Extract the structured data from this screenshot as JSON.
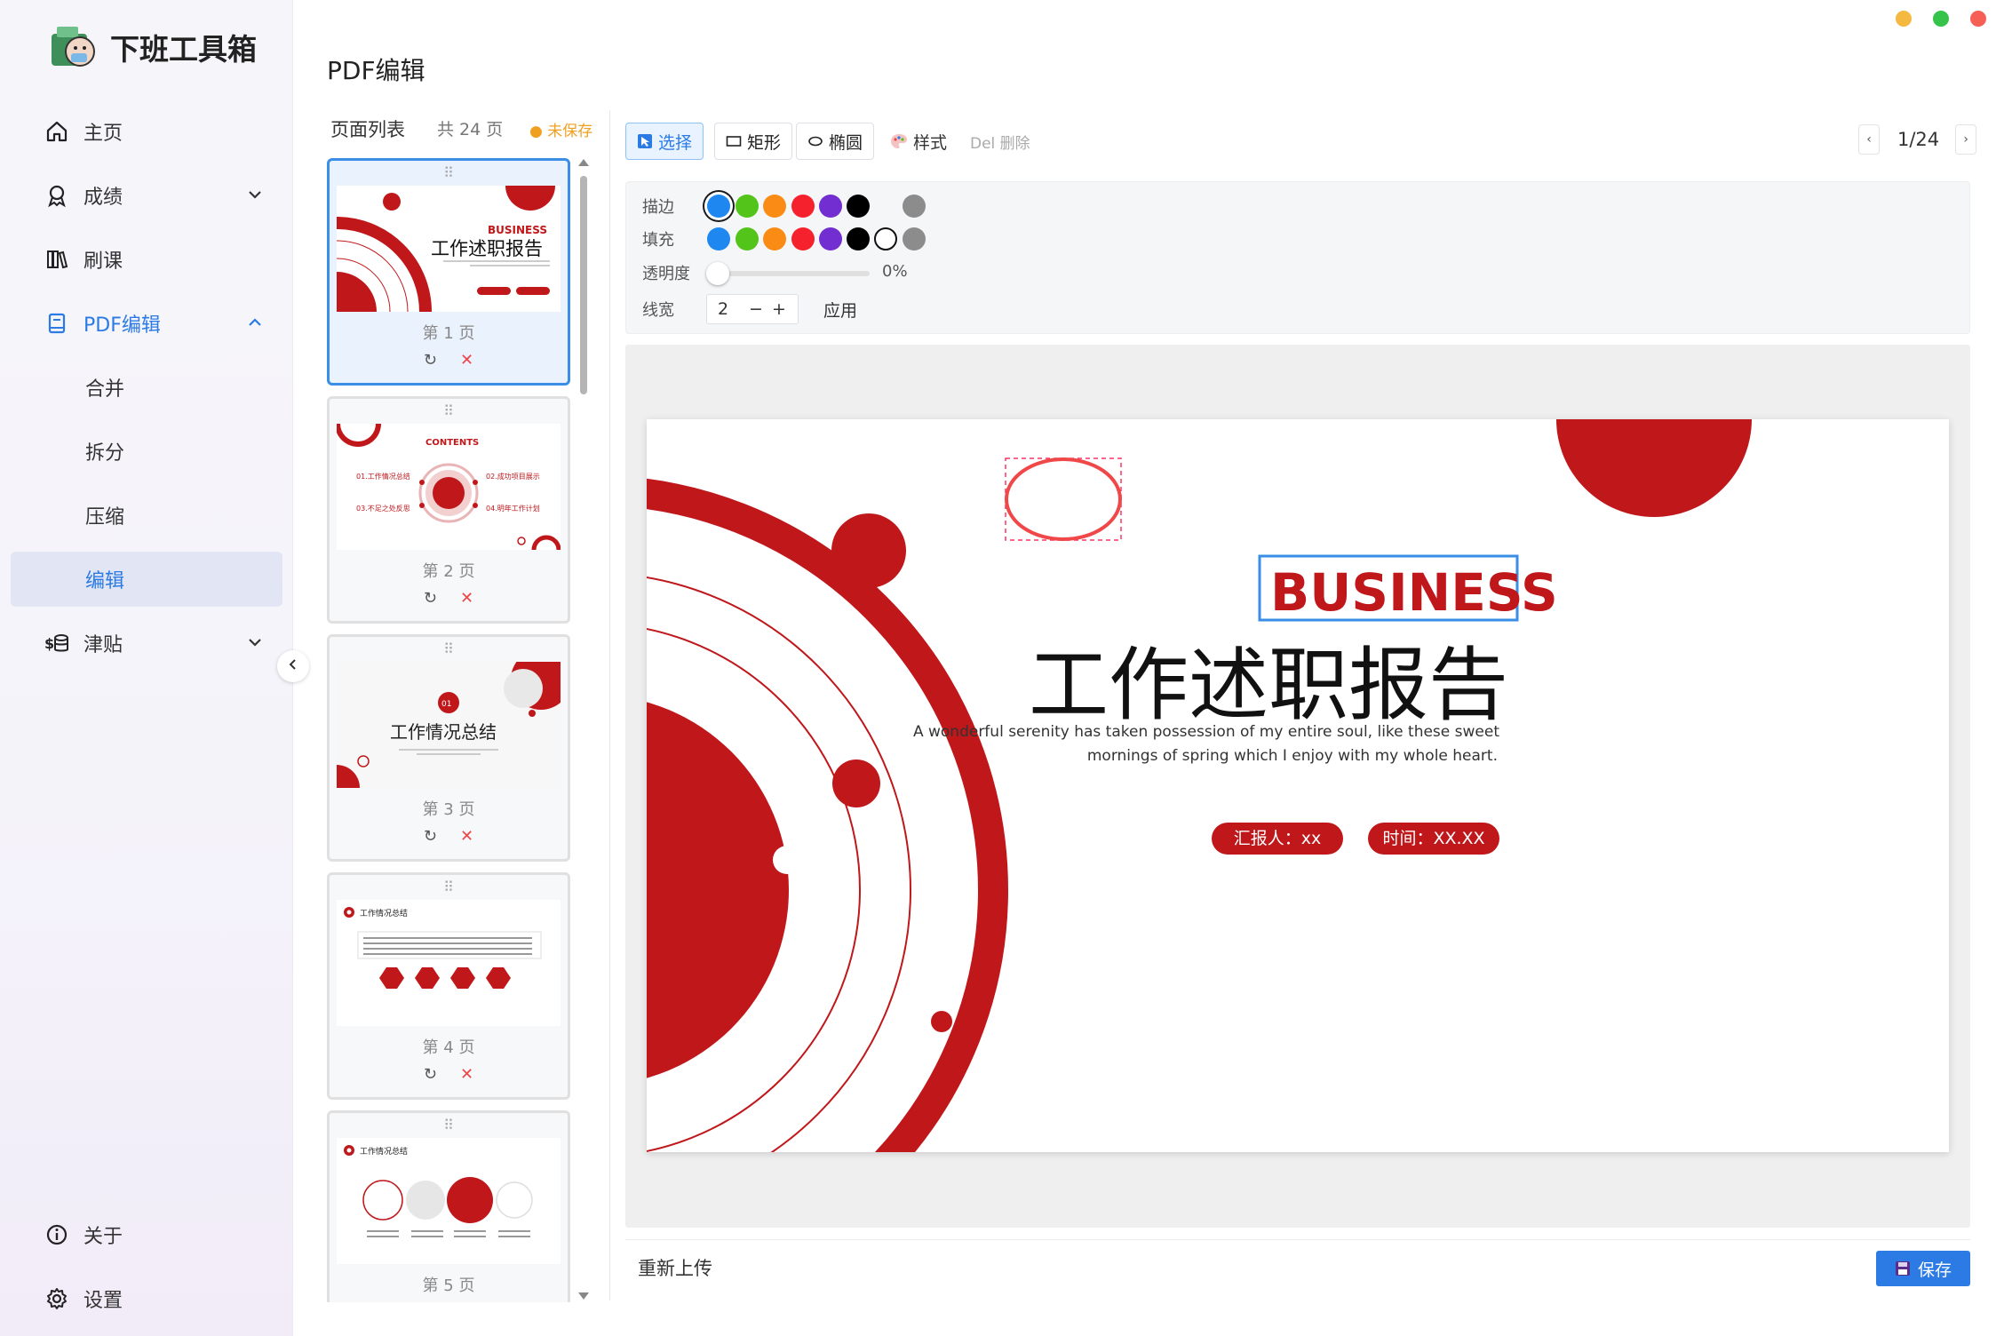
{
  "app": {
    "name": "下班工具箱",
    "page_title": "PDF编辑"
  },
  "window_controls": [
    {
      "name": "minimize",
      "color": "#f5b942"
    },
    {
      "name": "maximize",
      "color": "#35c34a"
    },
    {
      "name": "close",
      "color": "#f55f56"
    }
  ],
  "sidebar": {
    "items": [
      {
        "label": "主页",
        "icon": "home-icon"
      },
      {
        "label": "成绩",
        "icon": "award-icon",
        "expand": "chevron-down"
      },
      {
        "label": "刷课",
        "icon": "books-icon"
      },
      {
        "label": "PDF编辑",
        "icon": "book-icon",
        "expand": "chevron-up",
        "active": true
      },
      {
        "label": "津贴",
        "icon": "money-icon",
        "expand": "chevron-down"
      }
    ],
    "sub_items": [
      {
        "label": "合并"
      },
      {
        "label": "拆分"
      },
      {
        "label": "压缩"
      },
      {
        "label": "编辑",
        "selected": true
      }
    ],
    "bottom": [
      {
        "label": "关于",
        "icon": "info-icon"
      },
      {
        "label": "设置",
        "icon": "gear-icon"
      }
    ]
  },
  "page_list": {
    "title": "页面列表",
    "count": "共 24 页",
    "status": "● 未保存",
    "pages": [
      {
        "caption": "第 1 页",
        "selected": true
      },
      {
        "caption": "第 2 页"
      },
      {
        "caption": "第 3 页"
      },
      {
        "caption": "第 4 页"
      },
      {
        "caption": "第 5 页"
      }
    ],
    "thumb_text": {
      "p1_tag": "BUSINESS",
      "p1_title": "工作述职报告",
      "p2_title": "CONTENTS",
      "p2_items": [
        "01.工作情况总结",
        "02.成功项目展示",
        "03.不足之处反思",
        "04.明年工作计划"
      ],
      "p3_num": "01",
      "p3_title": "工作情况总结",
      "p4_title": "工作情况总结",
      "p5_title": "工作情况总结"
    }
  },
  "toolbar": {
    "select": "选择",
    "rect": "矩形",
    "ellipse": "椭圆",
    "style": "样式",
    "delete_hint": "Del 删除",
    "page_indicator": "1/24",
    "prev": "‹",
    "next": "›"
  },
  "style_panel": {
    "stroke_label": "描边",
    "fill_label": "填充",
    "opacity_label": "透明度",
    "opacity_value": "0%",
    "width_label": "线宽",
    "width_value": "2",
    "apply": "应用",
    "colors": [
      "#1e88f0",
      "#52c41a",
      "#fa8c16",
      "#f5222d",
      "#722ed1",
      "#000000",
      "#8c8c8c"
    ],
    "stroke_selected": "#1e88f0"
  },
  "slide": {
    "tag": "BUSINESS",
    "title": "工作述职报告",
    "subtitle_line1": "A wonderful serenity has taken possession of my entire soul, like these sweet",
    "subtitle_line2": "mornings of spring which I enjoy with my whole heart.",
    "reporter": "汇报人：xx",
    "time": "时间：XX.XX",
    "accent": "#c0171b"
  },
  "footer": {
    "reupload": "重新上传",
    "save": "保存"
  }
}
